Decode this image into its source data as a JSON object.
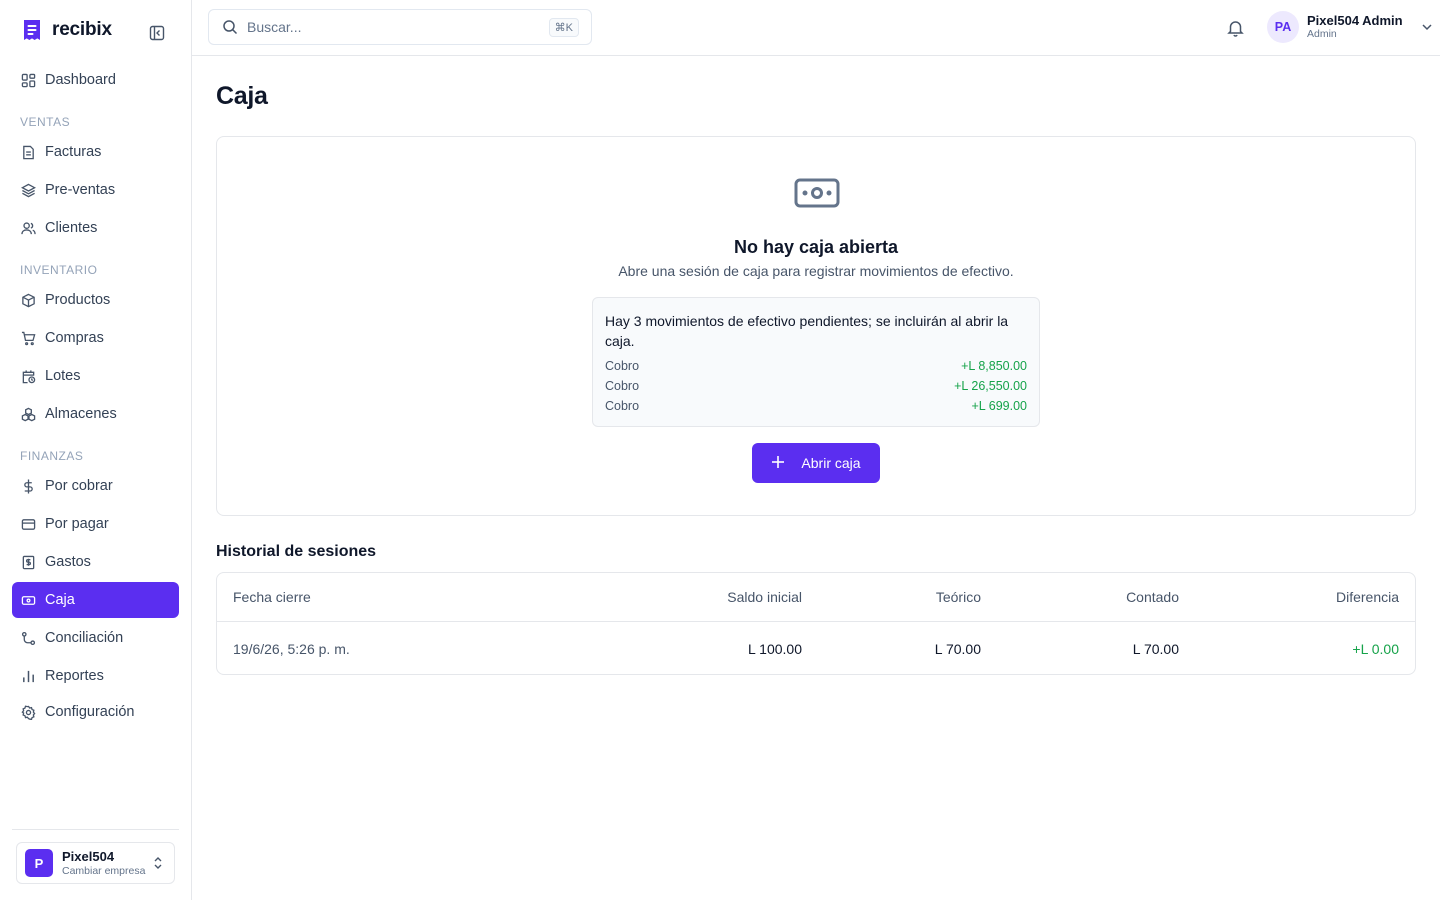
{
  "brand": {
    "name": "recibix"
  },
  "search": {
    "placeholder": "Buscar...",
    "shortcut": "⌘K"
  },
  "user": {
    "initials": "PA",
    "name": "Pixel504 Admin",
    "role": "Admin"
  },
  "sidebar": {
    "top_items": [
      {
        "label": "Dashboard",
        "icon": "dashboard-icon"
      }
    ],
    "sections": [
      {
        "label": "VENTAS",
        "items": [
          {
            "label": "Facturas",
            "icon": "file-text-icon"
          },
          {
            "label": "Pre-ventas",
            "icon": "layers-icon"
          },
          {
            "label": "Clientes",
            "icon": "users-icon"
          }
        ]
      },
      {
        "label": "INVENTARIO",
        "items": [
          {
            "label": "Productos",
            "icon": "package-icon"
          },
          {
            "label": "Compras",
            "icon": "cart-icon"
          },
          {
            "label": "Lotes",
            "icon": "calendar-clock-icon"
          },
          {
            "label": "Almacenes",
            "icon": "boxes-icon"
          }
        ]
      },
      {
        "label": "FINANZAS",
        "items": [
          {
            "label": "Por cobrar",
            "icon": "dollar-icon"
          },
          {
            "label": "Por pagar",
            "icon": "credit-card-icon"
          },
          {
            "label": "Gastos",
            "icon": "receipt-icon"
          },
          {
            "label": "Caja",
            "icon": "banknote-icon",
            "active": true
          },
          {
            "label": "Conciliación",
            "icon": "route-icon"
          },
          {
            "label": "Reportes",
            "icon": "bar-chart-icon"
          },
          {
            "label": "Configuración",
            "icon": "gear-icon"
          }
        ]
      }
    ]
  },
  "company": {
    "initial": "P",
    "name": "Pixel504",
    "action": "Cambiar empresa"
  },
  "page": {
    "title": "Caja"
  },
  "empty_state": {
    "title": "No hay caja abierta",
    "description": "Abre una sesión de caja para registrar movimientos de efectivo.",
    "pending_title": "Hay 3 movimientos de efectivo pendientes; se incluirán al abrir la caja.",
    "pending": [
      {
        "label": "Cobro",
        "amount": "+L 8,850.00"
      },
      {
        "label": "Cobro",
        "amount": "+L 26,550.00"
      },
      {
        "label": "Cobro",
        "amount": "+L 699.00"
      }
    ],
    "open_button": "Abrir caja"
  },
  "history": {
    "title": "Historial de sesiones",
    "columns": [
      "Fecha cierre",
      "Saldo inicial",
      "Teórico",
      "Contado",
      "Diferencia"
    ],
    "rows": [
      [
        "19/6/26, 5:26 p. m.",
        "L 100.00",
        "L 70.00",
        "L 70.00",
        "+L 0.00"
      ]
    ]
  },
  "colors": {
    "accent": "#5b2ef0",
    "positive": "#16a34a",
    "border": "#e5e7eb",
    "muted": "#64748b"
  }
}
